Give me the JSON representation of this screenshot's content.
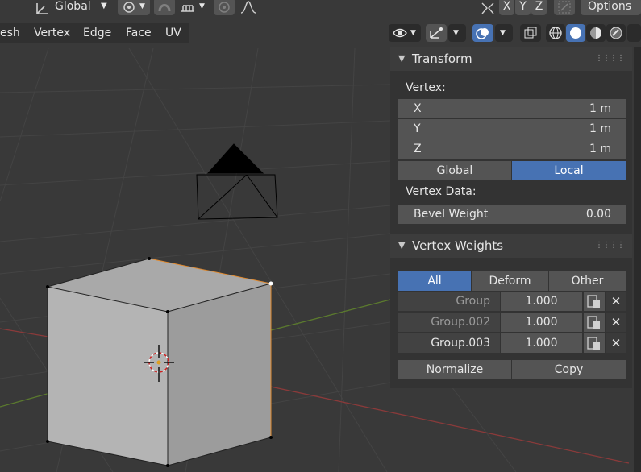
{
  "header": {
    "orientation": "Global",
    "options": "Options",
    "axis_x": "X",
    "axis_y": "Y",
    "axis_z": "Z"
  },
  "menu": {
    "mesh": "esh",
    "vertex": "Vertex",
    "edge": "Edge",
    "face": "Face",
    "uv": "UV"
  },
  "transform": {
    "title": "Transform",
    "vertex_label": "Vertex:",
    "fields": [
      {
        "label": "X",
        "value": "1 m"
      },
      {
        "label": "Y",
        "value": "1 m"
      },
      {
        "label": "Z",
        "value": "1 m"
      }
    ],
    "global": "Global",
    "local": "Local",
    "vertex_data_label": "Vertex Data:",
    "bevel_label": "Bevel Weight",
    "bevel_value": "0.00"
  },
  "vertex_weights": {
    "title": "Vertex Weights",
    "tabs": [
      "All",
      "Deform",
      "Other"
    ],
    "groups": [
      {
        "name": "Group",
        "weight": "1.000"
      },
      {
        "name": "Group.002",
        "weight": "1.000"
      },
      {
        "name": "Group.003",
        "weight": "1.000"
      }
    ],
    "normalize": "Normalize",
    "copy": "Copy"
  },
  "colors": {
    "accent": "#4772b3",
    "background": "#393939",
    "panel": "#333333"
  },
  "icons": [
    "transform-orientation-icon",
    "pivot-icon",
    "snap-icon",
    "proportional-icon",
    "mirror-icon",
    "visibility-icon",
    "gizmo-icon",
    "overlay-icon",
    "xray-icon",
    "shading-wireframe-icon",
    "shading-solid-icon",
    "shading-material-icon",
    "shading-rendered-icon"
  ]
}
